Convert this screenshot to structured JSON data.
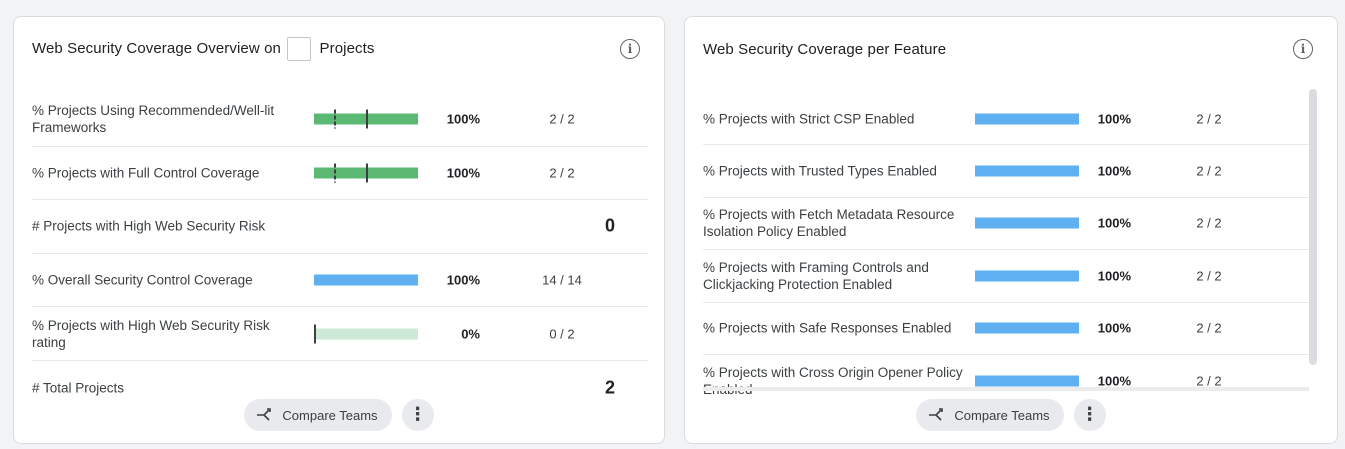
{
  "overview": {
    "title_before": "Web Security Coverage Overview on",
    "title_after": "Projects",
    "info_icon": "info-icon",
    "rows": [
      {
        "label": "% Projects Using Recommended/Well-lit Frameworks",
        "pct": "100%",
        "count": "2 / 2",
        "fill_fraction": 1.0,
        "bar_color": "#5bb974",
        "track_color": "#e6f4ea"
      },
      {
        "label": "% Projects with Full Control Coverage",
        "pct": "100%",
        "count": "2 / 2",
        "fill_fraction": 1.0,
        "bar_color": "#5bb974",
        "track_color": "#e6f4ea"
      },
      {
        "label": "# Projects with High Web Security Risk",
        "value": "0"
      },
      {
        "label": "% Overall Security Control Coverage",
        "pct": "100%",
        "count": "14 / 14",
        "fill_fraction": 1.0,
        "bar_color": "#5fb0f0",
        "track_color": "#e8f0fe"
      },
      {
        "label": "% Projects with High Web Security Risk rating",
        "pct": "0%",
        "count": "0 / 2",
        "fill_fraction": 0.0,
        "bar_color": "#5bb974",
        "track_color": "#ceead6"
      },
      {
        "label": "# Total Projects",
        "value": "2"
      }
    ],
    "compare_label": "Compare Teams",
    "more_icon": "more-vert-icon"
  },
  "per_feature": {
    "title": "Web Security Coverage per Feature",
    "info_icon": "info-icon",
    "rows": [
      {
        "label": "% Projects with Strict CSP Enabled",
        "pct": "100%",
        "count": "2 / 2",
        "fill_fraction": 1.0
      },
      {
        "label": "% Projects with Trusted Types Enabled",
        "pct": "100%",
        "count": "2 / 2",
        "fill_fraction": 1.0
      },
      {
        "label": "% Projects with Fetch Metadata Resource Isolation Policy Enabled",
        "pct": "100%",
        "count": "2 / 2",
        "fill_fraction": 1.0
      },
      {
        "label": "% Projects with Framing Controls and Clickjacking Protection Enabled",
        "pct": "100%",
        "count": "2 / 2",
        "fill_fraction": 1.0
      },
      {
        "label": "% Projects with Safe Responses Enabled",
        "pct": "100%",
        "count": "2 / 2",
        "fill_fraction": 1.0
      },
      {
        "label": "% Projects with Cross Origin Opener Policy Enabled",
        "pct": "100%",
        "count": "2 / 2",
        "fill_fraction": 1.0
      }
    ],
    "bar_color": "#5fb0f0",
    "compare_label": "Compare Teams",
    "more_icon": "more-vert-icon"
  }
}
